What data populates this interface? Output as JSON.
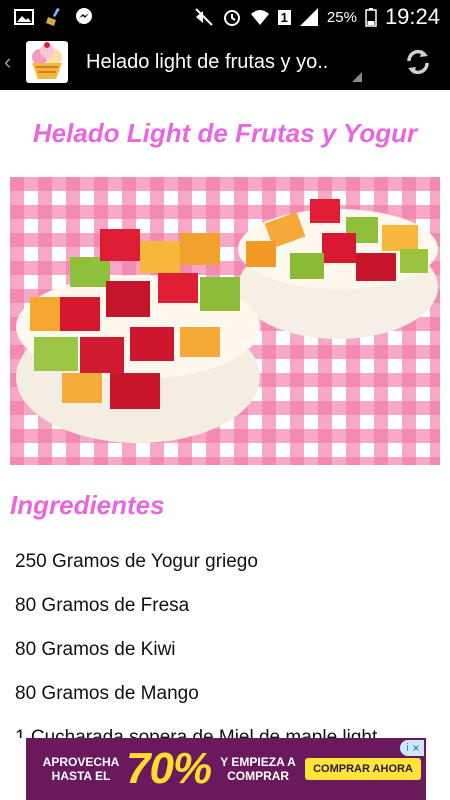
{
  "status_bar": {
    "battery": "25%",
    "sim_slot": "1",
    "time": "19:24"
  },
  "app_bar": {
    "title": "Helado light de frutas y yo..",
    "app_icon": "ice-cream-sundae-icon",
    "refresh_icon": "refresh-icon"
  },
  "recipe": {
    "title": "Helado Light de Frutas y Yogur",
    "photo": "fruit-yogurt-ice-cream-photo"
  },
  "ingredients": {
    "heading": "Ingredientes",
    "items": [
      "250 Gramos de Yogur griego",
      "80 Gramos de Fresa",
      "80 Gramos de Kiwi",
      "80 Gramos de Mango",
      "1 Cucharada sopera de Miel de maple light"
    ]
  },
  "ad": {
    "left_text": "APROVECHA HASTA EL",
    "big_text": "70%",
    "right_text": "Y EMPIEZA A COMPRAR",
    "cta": "COMPRAR AHORA",
    "colors": {
      "bg": "#6a1a5c",
      "accent": "#ffde2e"
    }
  },
  "colors": {
    "title_pink": "#e866e0",
    "bar_black": "#000000"
  }
}
